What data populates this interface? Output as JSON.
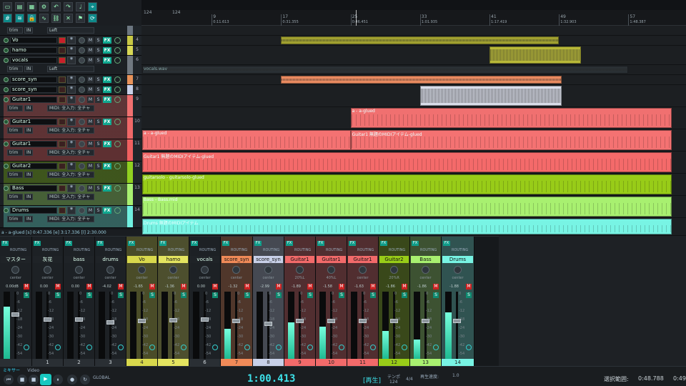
{
  "colors": {
    "accent": "#18c8c0",
    "rec": "#c8202a",
    "fx": "#10a890"
  },
  "ruler": {
    "tempo_left": "124",
    "tempo_right": "124",
    "bars": [
      {
        "label": "9",
        "sub": "0:11.613"
      },
      {
        "label": "17",
        "sub": "0:31.355"
      },
      {
        "label": "25",
        "sub": "0:46.451"
      },
      {
        "label": "33",
        "sub": "1:01.935"
      },
      {
        "label": "41",
        "sub": "1:17.419"
      },
      {
        "label": "49",
        "sub": "1:32.903"
      },
      {
        "label": "57",
        "sub": "1:48.387"
      }
    ]
  },
  "tracks": [
    {
      "name": "trim",
      "num": "",
      "route": "Left",
      "color": "#6c7680",
      "armed": false,
      "subrow": false
    },
    {
      "name": "Vo",
      "num": "4",
      "color": "#c8c844",
      "armed": true
    },
    {
      "name": "hamo",
      "num": "5",
      "color": "#d8d855",
      "armed": false
    },
    {
      "name": "vocals",
      "num": "6",
      "trim": "trim",
      "in": "IN",
      "route": "Left",
      "color": "#707880",
      "armed": true
    },
    {
      "name": "score_syn",
      "num": "7",
      "color": "#e8925a",
      "armed": false
    },
    {
      "name": "score_syn",
      "num": "8",
      "color": "#c8d0e8",
      "armed": false
    },
    {
      "name": "Guitar1",
      "num": "9",
      "trim": "trim",
      "in": "IN",
      "route": "MIDI: 全入力: 全チャ",
      "color": "#f07070",
      "armed": false
    },
    {
      "name": "Guitar1",
      "num": "10",
      "trim": "trim",
      "in": "IN",
      "route": "MIDI: 全入力: 全チャ",
      "color": "#f06868",
      "armed": false
    },
    {
      "name": "Guitar1",
      "num": "11",
      "trim": "trim",
      "in": "IN",
      "route": "MIDI: 全入力: 全チャ",
      "color": "#f06060",
      "armed": false
    },
    {
      "name": "Guitar2",
      "num": "12",
      "trim": "trim",
      "in": "IN",
      "route": "MIDI: 全入力: 全チャ",
      "color": "#90d020",
      "armed": false
    },
    {
      "name": "Bass",
      "num": "13",
      "trim": "trim",
      "in": "IN",
      "route": "MIDI: 全入力: 全チャ",
      "color": "#a8f070",
      "armed": false
    },
    {
      "name": "Drums",
      "num": "14",
      "trim": "trim",
      "in": "IN",
      "route": "MIDI: 全入力: 全チャ",
      "color": "#70f0e0",
      "armed": false
    }
  ],
  "tcp_status": "a - a-glued [s] 0:47.336 [e] 3:17.336 [l] 2:30.000",
  "items": [
    {
      "lane": 1,
      "label": "",
      "start": 17,
      "end": 49,
      "color": "#a0a030",
      "kind": "wave"
    },
    {
      "lane": 2,
      "label": "",
      "start": 41,
      "end": 51.5,
      "color": "#b8b838",
      "kind": "wave"
    },
    {
      "lane": 3,
      "label": "vocals.wav",
      "start": 1,
      "end": 57,
      "color": "#2a3034",
      "kind": "wave"
    },
    {
      "lane": 4,
      "label": "",
      "start": 17,
      "end": 49.3,
      "color": "#e88a60",
      "kind": "wave"
    },
    {
      "lane": 5,
      "label": "",
      "start": 33,
      "end": 49.3,
      "color": "#d8dce8",
      "kind": "wave"
    },
    {
      "lane": 6,
      "label": "a - a-glued",
      "start": 25,
      "end": 62,
      "color": "#f07070",
      "kind": "midi"
    },
    {
      "lane": 7,
      "label": "a - a-glued",
      "start": 1,
      "end": 25,
      "color": "#f47272",
      "kind": "midi"
    },
    {
      "lane": 7,
      "label": "Guitar1 無題のMIDIアイテム-glued",
      "start": 25,
      "end": 62,
      "color": "#f47272",
      "kind": "midi"
    },
    {
      "lane": 8,
      "label": "Guitar1 無題のMIDIアイテム-glued",
      "start": 1,
      "end": 62,
      "color": "#f46a6a",
      "kind": "midi"
    },
    {
      "lane": 9,
      "label": "guitarsolo - guitarsolo-glued",
      "start": 1,
      "end": 62,
      "color": "#98cc18",
      "kind": "midi"
    },
    {
      "lane": 10,
      "label": "Bass - Bass.mid",
      "start": 1,
      "end": 62,
      "color": "#a8f070",
      "kind": "midi"
    },
    {
      "lane": 11,
      "label": "Drums 無題のMIDIアイテム",
      "start": 1,
      "end": 62,
      "color": "#78f4e4",
      "kind": "midi"
    }
  ],
  "cursor_bar": 25.6,
  "mixer": {
    "strips": [
      {
        "name": "マスター",
        "vol": "0.00dB",
        "pan": "center",
        "num": "",
        "color": "#1d2125",
        "level": 0.78,
        "fader": 0.7
      },
      {
        "name": "灰花",
        "vol": "0.00",
        "pan": "center",
        "num": "1",
        "color": "#1d2125",
        "level": 0,
        "fader": 0.62
      },
      {
        "name": "bass",
        "vol": "0.00",
        "pan": "center",
        "num": "2",
        "color": "#1d2125",
        "level": 0,
        "fader": 0.62
      },
      {
        "name": "drums",
        "vol": "-4.02",
        "pan": "center",
        "num": "3",
        "color": "#1d2125",
        "level": 0,
        "fader": 0.58
      },
      {
        "name": "Vo",
        "vol": "-1.65",
        "pan": "center",
        "num": "4",
        "color": "#d8d84c",
        "level": 0,
        "fader": 0.6
      },
      {
        "name": "hamo",
        "vol": "-1.36",
        "pan": "center",
        "num": "5",
        "color": "#e4e460",
        "level": 0,
        "fader": 0.61
      },
      {
        "name": "vocals",
        "vol": "0.00",
        "pan": "center",
        "num": "6",
        "color": "#1d2125",
        "level": 0,
        "fader": 0.62
      },
      {
        "name": "score_syn",
        "vol": "-1.32",
        "pan": "center",
        "num": "7",
        "color": "#f08a58",
        "level": 0.45,
        "fader": 0.6
      },
      {
        "name": "score_syn",
        "vol": "-2.99",
        "pan": "center",
        "num": "8",
        "color": "#c8d0e8",
        "level": 0,
        "fader": 0.56
      },
      {
        "name": "Guitar1",
        "vol": "-1.89",
        "pan": "20%L",
        "num": "9",
        "color": "#f26a6a",
        "level": 0.55,
        "fader": 0.6
      },
      {
        "name": "Guitar1",
        "vol": "-1.58",
        "pan": "40%L",
        "num": "10",
        "color": "#f26a6a",
        "level": 0.48,
        "fader": 0.6
      },
      {
        "name": "Guitar1",
        "vol": "-1.63",
        "pan": "center",
        "num": "11",
        "color": "#f26a6a",
        "level": 0,
        "fader": 0.6
      },
      {
        "name": "Guitar2",
        "vol": "-1.86",
        "pan": "20%R",
        "num": "12",
        "color": "#98cc18",
        "level": 0.42,
        "fader": 0.6
      },
      {
        "name": "Bass",
        "vol": "-1.86",
        "pan": "center",
        "num": "13",
        "color": "#a8f070",
        "level": 0.3,
        "fader": 0.6
      },
      {
        "name": "Drums",
        "vol": "-1.88",
        "pan": "center",
        "num": "14",
        "color": "#78f4e4",
        "level": 0.7,
        "fader": 0.6
      }
    ],
    "scale": [
      "0",
      "-6",
      "-12",
      "-18",
      "-24",
      "-30",
      "-42",
      "-54"
    ]
  },
  "transport": {
    "tabs": [
      "ミキサー",
      "Video"
    ],
    "time": "1:00.413",
    "state": "[再生]",
    "tempo_label": "テンポ",
    "tempo": "124",
    "sig": "4/4",
    "rate_label": "再生速度:",
    "rate": "1.0",
    "sel_label": "選択範囲:",
    "sel_start": "0:48.788",
    "sel_end": "0:49"
  }
}
